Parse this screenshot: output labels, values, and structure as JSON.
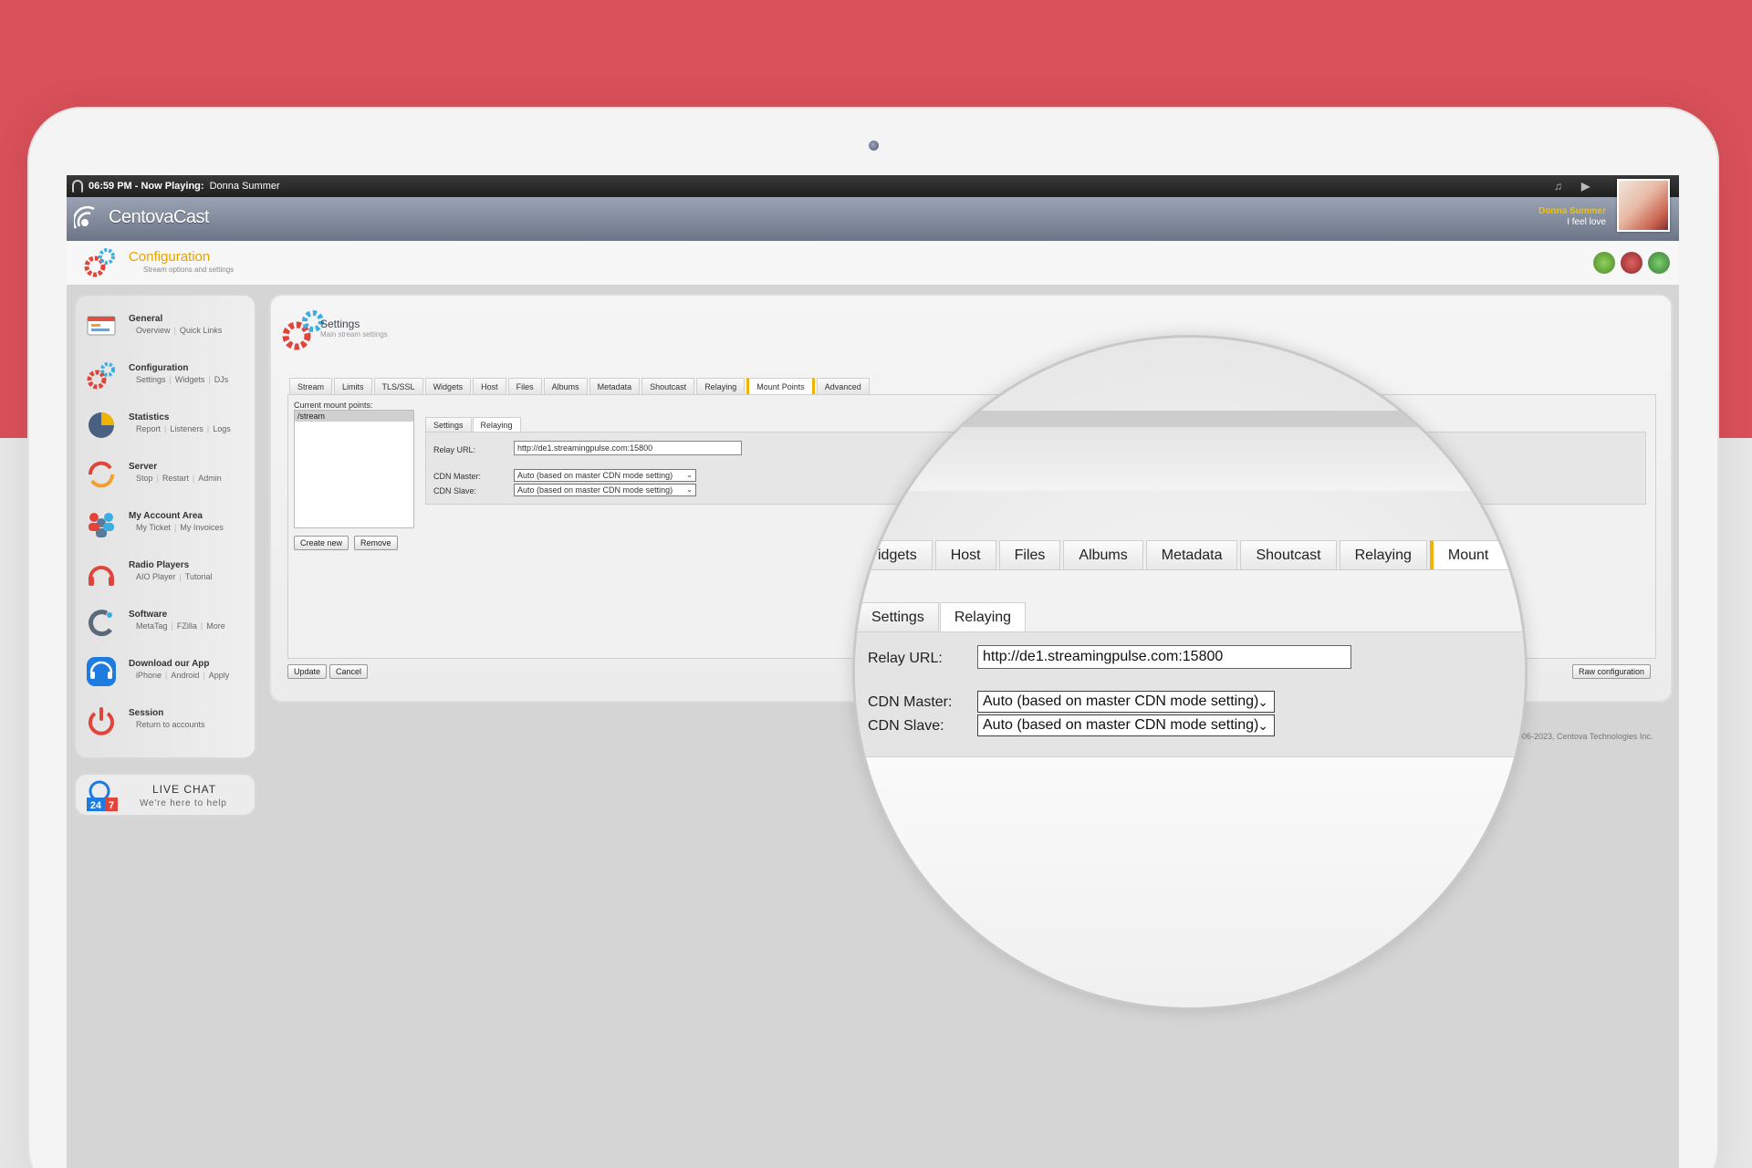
{
  "topbar": {
    "time": "06:59 PM",
    "now_playing_label": "- Now Playing:",
    "artist": "Donna Summer",
    "song_artist": "Donna Summer",
    "song_title": "I feel love"
  },
  "brand": {
    "name": "CentovaCast"
  },
  "header": {
    "title": "Configuration",
    "subtitle": "Stream options and settings"
  },
  "sidebar": {
    "items": [
      {
        "title": "General",
        "links": [
          "Overview",
          "Quick Links"
        ]
      },
      {
        "title": "Configuration",
        "links": [
          "Settings",
          "Widgets",
          "DJs"
        ]
      },
      {
        "title": "Statistics",
        "links": [
          "Report",
          "Listeners",
          "Logs"
        ]
      },
      {
        "title": "Server",
        "links": [
          "Stop",
          "Restart",
          "Admin"
        ]
      },
      {
        "title": "My Account Area",
        "links": [
          "My Ticket",
          "My Invoices"
        ]
      },
      {
        "title": "Radio Players",
        "links": [
          "AIO Player",
          "Tutorial"
        ]
      },
      {
        "title": "Software",
        "links": [
          "MetaTag",
          "FZilla",
          "More"
        ]
      },
      {
        "title": "Download our App",
        "links": [
          "iPhone",
          "Android",
          "Apply"
        ]
      },
      {
        "title": "Session",
        "links": [
          "Return to accounts"
        ]
      }
    ]
  },
  "livechat": {
    "title": "LIVE CHAT",
    "subtitle": "We're here to help",
    "badge_left": "24",
    "badge_right": "7"
  },
  "settings": {
    "title": "Settings",
    "subtitle": "Main stream settings",
    "tabs": [
      "Stream",
      "Limits",
      "TLS/SSL",
      "Widgets",
      "Host",
      "Files",
      "Albums",
      "Metadata",
      "Shoutcast",
      "Relaying",
      "Mount Points",
      "Advanced"
    ],
    "active_tab": "Mount Points",
    "current_mount_points_label": "Current mount points:",
    "mount_points": [
      "/stream"
    ],
    "create_new_label": "Create new",
    "remove_label": "Remove",
    "inner_tabs": [
      "Settings",
      "Relaying"
    ],
    "active_inner_tab": "Relaying",
    "relay_url_label": "Relay URL:",
    "relay_url_value": "http://de1.streamingpulse.com:15800",
    "cdn_master_label": "CDN Master:",
    "cdn_master_value": "Auto (based on master CDN mode setting)",
    "cdn_slave_label": "CDN Slave:",
    "cdn_slave_value": "Auto (based on master CDN mode setting)",
    "update_label": "Update",
    "cancel_label": "Cancel",
    "raw_config_label": "Raw configuration"
  },
  "copyright": "006-2023, Centova Technologies Inc.",
  "magnifier": {
    "tabs": [
      "idgets",
      "Host",
      "Files",
      "Albums",
      "Metadata",
      "Shoutcast",
      "Relaying",
      "Mount Points"
    ],
    "active_tab": "Mount Points"
  },
  "colors": {
    "accent": "#f0b400",
    "background": "#d9505a",
    "brand_bar": "#7f8899"
  }
}
